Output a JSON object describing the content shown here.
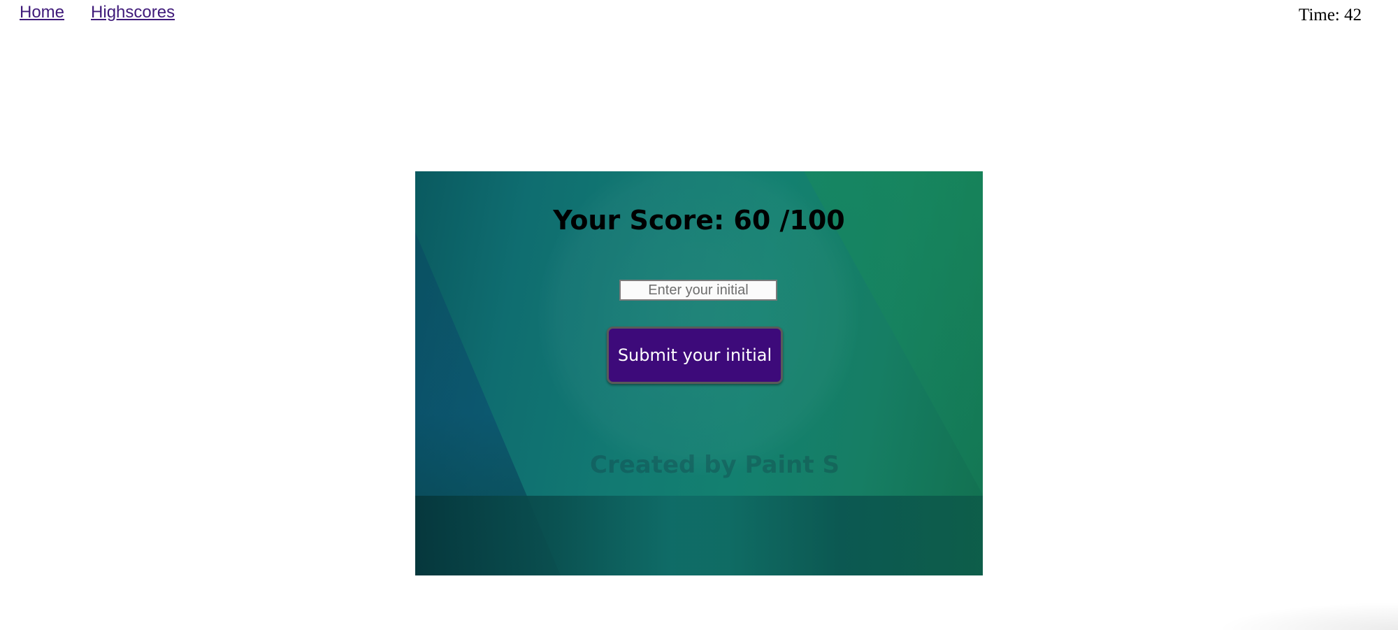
{
  "nav": {
    "home_label": "Home",
    "highscores_label": "Highscores"
  },
  "timer": {
    "text": "Time: 42"
  },
  "result": {
    "score_text": "Your Score: 60 /100",
    "initial_placeholder": "Enter your initial",
    "initial_value": "",
    "submit_label": "Submit your initial",
    "watermark_text": "Created by Paint S"
  },
  "colors": {
    "link": "#3f1a7a",
    "button_bg": "#3d0a7a",
    "card_accent": "#127a72"
  }
}
